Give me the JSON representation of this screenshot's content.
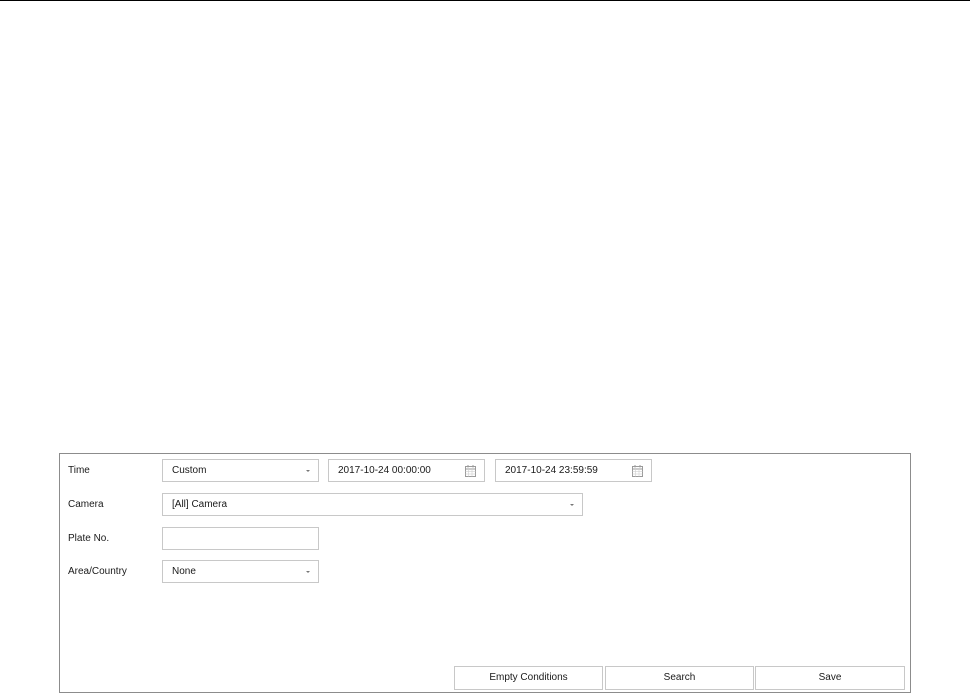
{
  "form": {
    "time_label": "Time",
    "time_mode": "Custom",
    "start_time": "2017-10-24 00:00:00",
    "end_time": "2017-10-24 23:59:59",
    "camera_label": "Camera",
    "camera_value": "[All] Camera",
    "plate_label": "Plate No.",
    "plate_value": "",
    "area_label": "Area/Country",
    "area_value": "None"
  },
  "buttons": {
    "empty_conditions": "Empty Conditions",
    "search": "Search",
    "save": "Save"
  },
  "icons": {
    "dropdown": "chevron-down-icon",
    "calendar": "calendar-icon"
  },
  "colors": {
    "panel_border": "#8c8c8c",
    "field_border": "#c8c8c8",
    "text": "#1a1a1a"
  }
}
